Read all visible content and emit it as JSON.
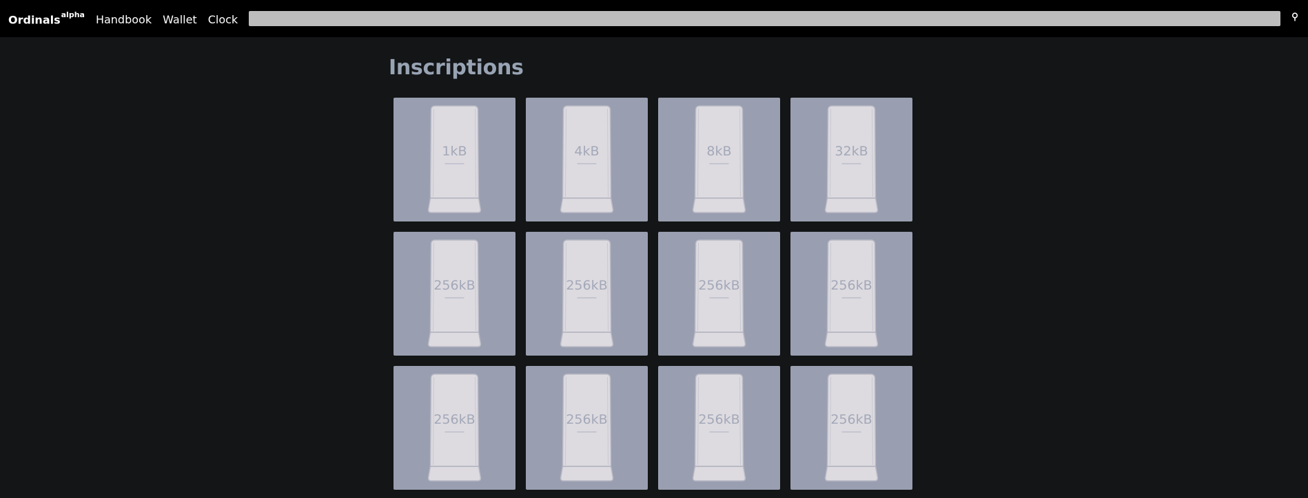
{
  "nav": {
    "brand": "Ordinals",
    "brand_sup": "alpha",
    "links": [
      "Handbook",
      "Wallet",
      "Clock"
    ],
    "search_placeholder": "",
    "search_icon": "search-icon"
  },
  "page": {
    "title": "Inscriptions"
  },
  "colors": {
    "background": "#131516",
    "navbar": "#000000",
    "card": "#999eb0",
    "bar": "#dddbe0",
    "label": "#a3a8b8",
    "title": "#98a3b3"
  },
  "inscriptions": [
    {
      "size": "1kB"
    },
    {
      "size": "4kB"
    },
    {
      "size": "8kB"
    },
    {
      "size": "32kB"
    },
    {
      "size": "256kB"
    },
    {
      "size": "256kB"
    },
    {
      "size": "256kB"
    },
    {
      "size": "256kB"
    },
    {
      "size": "256kB"
    },
    {
      "size": "256kB"
    },
    {
      "size": "256kB"
    },
    {
      "size": "256kB"
    }
  ]
}
